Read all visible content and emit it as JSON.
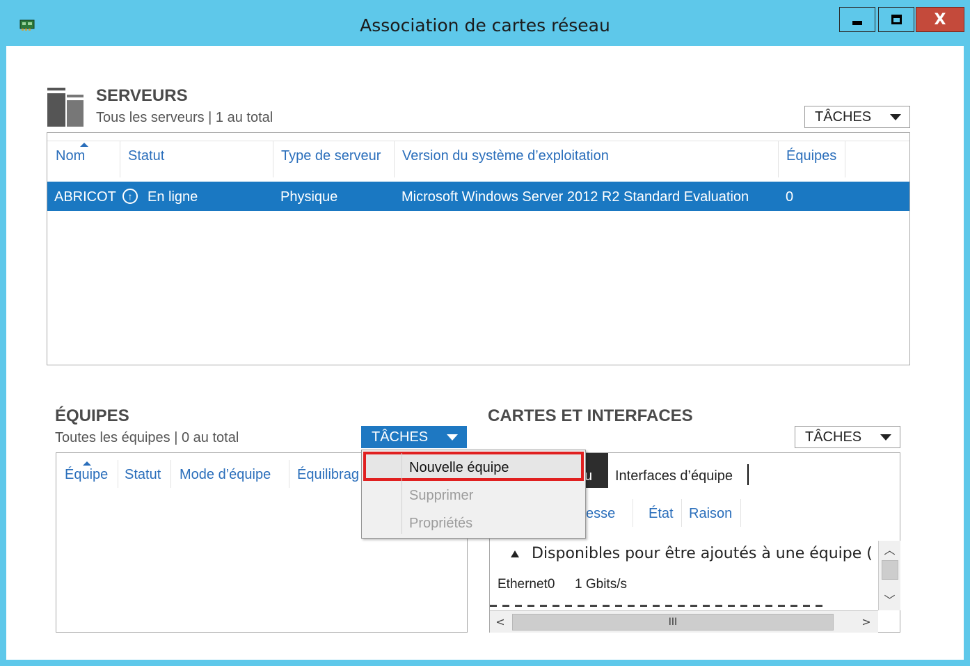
{
  "window": {
    "title": "Association de cartes réseau",
    "close_label": "X"
  },
  "servers": {
    "title": "SERVEURS",
    "subtitle": "Tous les serveurs | 1 au total",
    "tasks_label": "TÂCHES",
    "columns": [
      "Nom",
      "Statut",
      "Type de serveur",
      "Version du système d’exploitation",
      "Équipes"
    ],
    "rows": [
      {
        "name": "ABRICOT",
        "status": "En ligne",
        "type": "Physique",
        "os": "Microsoft Windows Server 2012 R2 Standard Evaluation",
        "teams": "0"
      }
    ]
  },
  "teams": {
    "title": "ÉQUIPES",
    "subtitle": "Toutes les équipes | 0 au total",
    "tasks_label": "TÂCHES",
    "columns": [
      "Équipe",
      "Statut",
      "Mode d’équipe",
      "Équilibrag"
    ]
  },
  "tasks_menu": {
    "items": [
      {
        "label": "Nouvelle équipe",
        "enabled": true
      },
      {
        "label": "Supprimer",
        "enabled": false
      },
      {
        "label": "Propriétés",
        "enabled": false
      }
    ]
  },
  "adapters": {
    "title": "CARTES ET INTERFACES",
    "tasks_label": "TÂCHES",
    "tab_partial": "u",
    "tab_team_interfaces": "Interfaces d’équipe",
    "columns": [
      "itesse",
      "État",
      "Raison"
    ],
    "group_label": "Disponibles pour être ajoutés à une équipe (",
    "row_name": "Ethernet0",
    "row_speed": "1 Gbits/s",
    "scroll_mid": "III"
  },
  "colors": {
    "titlebar": "#5ec8ea",
    "selection": "#1a78c2",
    "link": "#2a6ebb",
    "highlight_border": "#e02020",
    "close_button": "#c44a3b"
  }
}
